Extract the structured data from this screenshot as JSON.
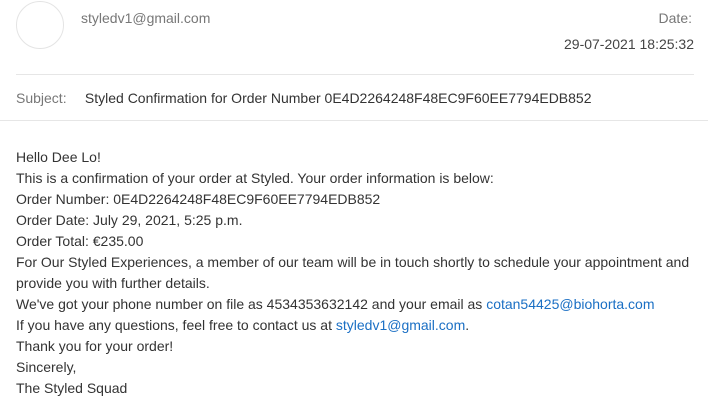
{
  "header": {
    "sender": "styledv1@gmail.com",
    "date_label": "Date:",
    "date_value": "29-07-2021 18:25:32"
  },
  "subject": {
    "label": "Subject:",
    "text": "Styled Confirmation for Order Number 0E4D2264248F48EC9F60EE7794EDB852"
  },
  "email_body": {
    "greeting": "Hello Dee Lo!",
    "intro": "This is a confirmation of your order at Styled. Your order information is below:",
    "order_number": "Order Number: 0E4D2264248F48EC9F60EE7794EDB852",
    "order_date": "Order Date: July 29, 2021, 5:25 p.m.",
    "order_total": "Order Total: €235.00",
    "experiences_note": "For Our Styled Experiences, a member of our team will be in touch shortly to schedule your appointment and provide you with further details.",
    "contact_on_file_prefix": "We've got your phone number on file as 4534353632142 and your email as ",
    "customer_email": "cotan54425@biohorta.com",
    "questions_prefix": "If you have any questions, feel free to contact us at ",
    "support_email": "styledv1@gmail.com",
    "questions_suffix": ".",
    "thanks": "Thank you for your order!",
    "signoff": "Sincerely,",
    "signature": "The Styled Squad"
  },
  "colors": {
    "link": "#1a6fc4",
    "muted_text": "#777777",
    "divider": "#e6e6e6"
  }
}
